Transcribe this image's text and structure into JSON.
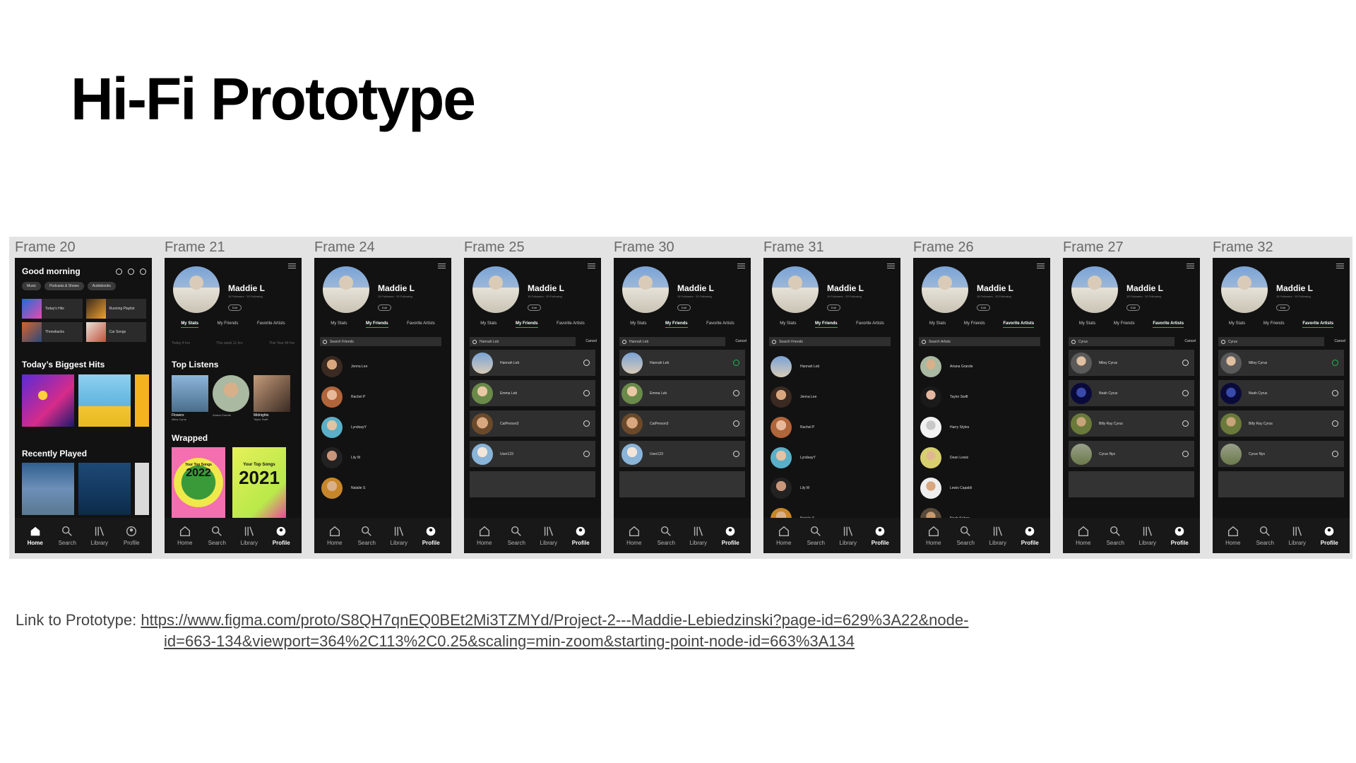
{
  "slide": {
    "title": "Hi-Fi Prototype",
    "link_label": "Link to Prototype:",
    "link_line1": "https://www.figma.com/proto/S8QH7qnEQ0BEt2Mi3TZMYd/Project-2---Maddie-Lebiedzinski?page-id=629%3A22&node-",
    "link_line2": "id=663-134&viewport=364%2C113%2C0.25&scaling=min-zoom&starting-point-node-id=663%3A134"
  },
  "nav": {
    "home": "Home",
    "search": "Search",
    "library": "Library",
    "profile": "Profile"
  },
  "profile": {
    "name": "Maddie L",
    "followers": "15 Followers · 20 Following",
    "edit": "Edit",
    "tabs": [
      "My Stats",
      "My Friends",
      "Favorite Artists"
    ],
    "cancel": "Cancel"
  },
  "frames": {
    "f20": {
      "label": "Frame 20",
      "greeting": "Good morning",
      "chips": [
        "Music",
        "Podcasts & Shows",
        "Audiobooks"
      ],
      "tiles": [
        "Today's Hits",
        "Running Playlist",
        "Throwbacks",
        "Car Songs"
      ],
      "section1": "Today’s Biggest Hits",
      "section2": "Recently Played"
    },
    "f21": {
      "label": "Frame 21",
      "stats": [
        "Today 4 hrs",
        "This week 11 hrs",
        "This Year 84 hrs"
      ],
      "top_listens": "Top Listens",
      "items": [
        {
          "title": "Flowers",
          "sub": "Miley Cyrus"
        },
        {
          "title": "",
          "sub": "Ariana Grande"
        },
        {
          "title": "Midnights",
          "sub": "Taylor Swift"
        }
      ],
      "wrapped": "Wrapped",
      "wrap_cards": [
        "2022",
        "2021"
      ],
      "wrap_sub": "Your Top Songs"
    },
    "f24": {
      "label": "Frame 24",
      "search": "Search Friends",
      "rows": [
        "Jenna Lee",
        "Rachel P",
        "LyndsayY",
        "Lily M",
        "Natalie S"
      ]
    },
    "f25": {
      "label": "Frame 25",
      "search": "Hannah Leb",
      "rows": [
        "Hannah Leb",
        "Emma Leb",
        "CatPerson3",
        "User123"
      ]
    },
    "f30": {
      "label": "Frame 30",
      "search": "Hannah Leb",
      "rows": [
        "Hannah Leb",
        "Emma Leb",
        "CatPerson3",
        "User123"
      ]
    },
    "f31": {
      "label": "Frame 31",
      "search": "Search Friends",
      "rows": [
        "Hannah Leb",
        "Jenna Lee",
        "Rachel P",
        "LyndsayY",
        "Lily M",
        "Natalie S"
      ]
    },
    "f26": {
      "label": "Frame 26",
      "search": "Search Artists",
      "rows": [
        "Ariana Grande",
        "Taylor Swift",
        "Harry Styles",
        "Dean Lewis",
        "Lewis Capaldi",
        "Noah Kahan"
      ]
    },
    "f27": {
      "label": "Frame 27",
      "search": "Cyrus",
      "rows": [
        "Miley Cyrus",
        "Noah Cyrus",
        "Billy Ray Cyrus",
        "Cyrus Nyx"
      ]
    },
    "f32": {
      "label": "Frame 32",
      "search": "Cyrus",
      "rows": [
        "Miley Cyrus",
        "Noah Cyrus",
        "Billy Ray Cyrus",
        "Cyrus Nyx"
      ]
    }
  },
  "colors": {
    "accent": "#1db954",
    "phone_bg": "#121212",
    "canvas_bg": "#e3e3e3"
  }
}
